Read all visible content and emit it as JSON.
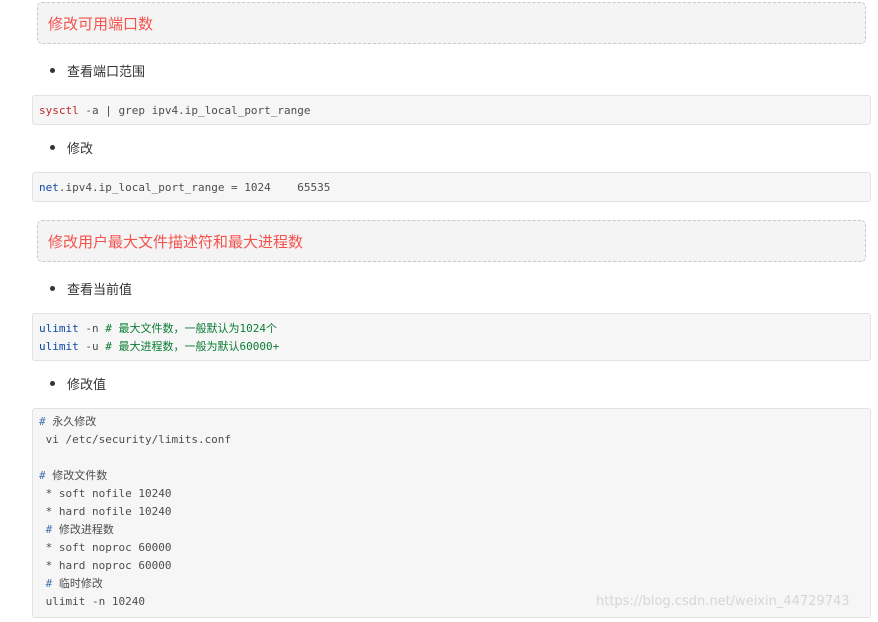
{
  "sections": {
    "port": {
      "heading": "修改可用端口数",
      "bullet_view": "查看端口范围",
      "code_view": {
        "cmd": "sysctl",
        "rest": " -a | grep ipv4.ip_local_port_range"
      },
      "bullet_modify": "修改",
      "code_modify": {
        "key": "net",
        "rest": ".ipv4.ip_local_port_range = 1024    65535"
      }
    },
    "limits": {
      "heading": "修改用户最大文件描述符和最大进程数",
      "bullet_view": "查看当前值",
      "code_view": {
        "line1_cmd": "ulimit",
        "line1_args": " -n ",
        "line1_comment": "# 最大文件数，一般默认为1024个",
        "line2_cmd": "ulimit",
        "line2_args": " -u ",
        "line2_comment": "# 最大进程数，一般为默认60000+"
      },
      "bullet_modify": "修改值",
      "code_modify": {
        "c1": "永久修改",
        "l2": " vi /etc/security/limits.conf",
        "c3": "修改文件数",
        "l4": " * soft nofile 10240",
        "l5": " * hard nofile 10240",
        "c6": "修改进程数",
        "l7": " * soft noproc 60000",
        "l8": " * hard noproc 60000",
        "c9": "临时修改",
        "l10": " ulimit -n 10240",
        "hash": "#"
      }
    }
  },
  "watermark": "https://blog.csdn.net/weixin_44729743"
}
